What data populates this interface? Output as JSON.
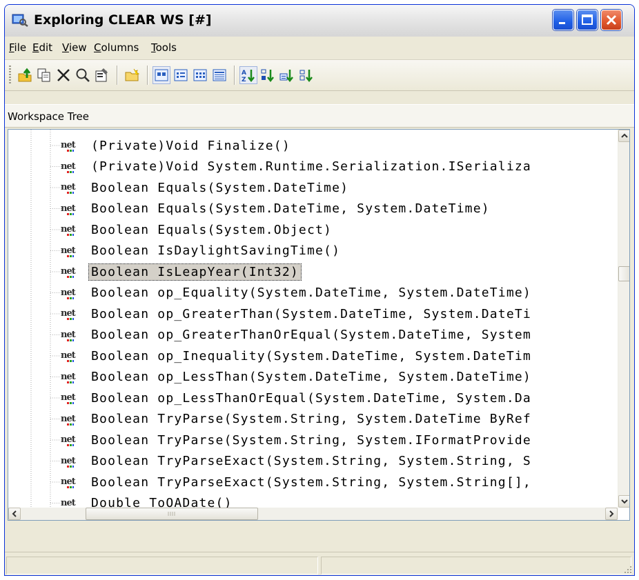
{
  "window": {
    "title": "Exploring CLEAR WS [#]"
  },
  "menu": [
    {
      "key": "F",
      "rest": "ile"
    },
    {
      "key": "E",
      "rest": "dit"
    },
    {
      "key": "V",
      "rest": "iew"
    },
    {
      "key": "C",
      "rest": "olumns"
    },
    {
      "key": "T",
      "rest": "ools"
    }
  ],
  "pane": {
    "title": "Workspace Tree"
  },
  "tree": {
    "items": [
      "(Private)Void Finalize()",
      "(Private)Void System.Runtime.Serialization.ISerializa",
      "Boolean Equals(System.DateTime)",
      "Boolean Equals(System.DateTime, System.DateTime)",
      "Boolean Equals(System.Object)",
      "Boolean IsDaylightSavingTime()",
      "Boolean IsLeapYear(Int32)",
      "Boolean op_Equality(System.DateTime, System.DateTime)",
      "Boolean op_GreaterThan(System.DateTime, System.DateTi",
      "Boolean op_GreaterThanOrEqual(System.DateTime, System",
      "Boolean op_Inequality(System.DateTime, System.DateTim",
      "Boolean op_LessThan(System.DateTime, System.DateTime)",
      "Boolean op_LessThanOrEqual(System.DateTime, System.Da",
      "Boolean TryParse(System.String, System.DateTime ByRef",
      "Boolean TryParse(System.String, System.IFormatProvide",
      "Boolean TryParseExact(System.String, System.String, S",
      "Boolean TryParseExact(System.String, System.String[],",
      "Double ToOADate()"
    ],
    "icon_text": "net",
    "selected_index": 6
  }
}
